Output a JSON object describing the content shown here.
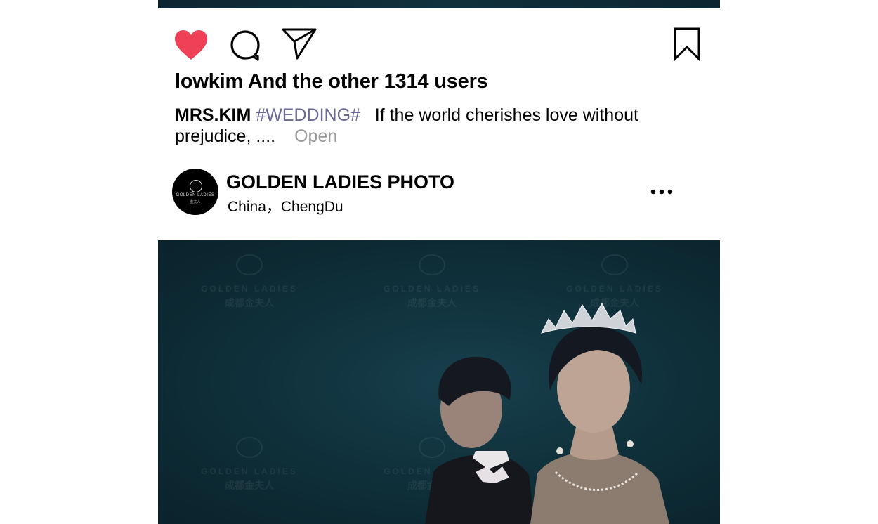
{
  "post": {
    "likes_text": "lowkim And the other 1314 users",
    "caption": {
      "username": "MRS.KIM",
      "hashtag": "#WEDDING#",
      "text": "If the world cherishes love without prejudice, ....",
      "open_label": "Open"
    },
    "profile": {
      "name": "GOLDEN LADIES PHOTO",
      "location": "China，ChengDu",
      "avatar_brand": "GOLDEN LADIES",
      "avatar_brand_sub": "金夫人"
    },
    "photo": {
      "watermark_text": "GOLDEN LADIES",
      "watermark_sub": "成都金夫人"
    }
  },
  "icons": {
    "like": "heart-icon",
    "comment": "comment-bubble-icon",
    "share": "send-icon",
    "save": "bookmark-icon",
    "more": "more-dots-icon"
  },
  "colors": {
    "like_active": "#ee4056",
    "hashtag": "#6a6896",
    "open_link": "#999999",
    "photo_bg": "#0f303a"
  }
}
